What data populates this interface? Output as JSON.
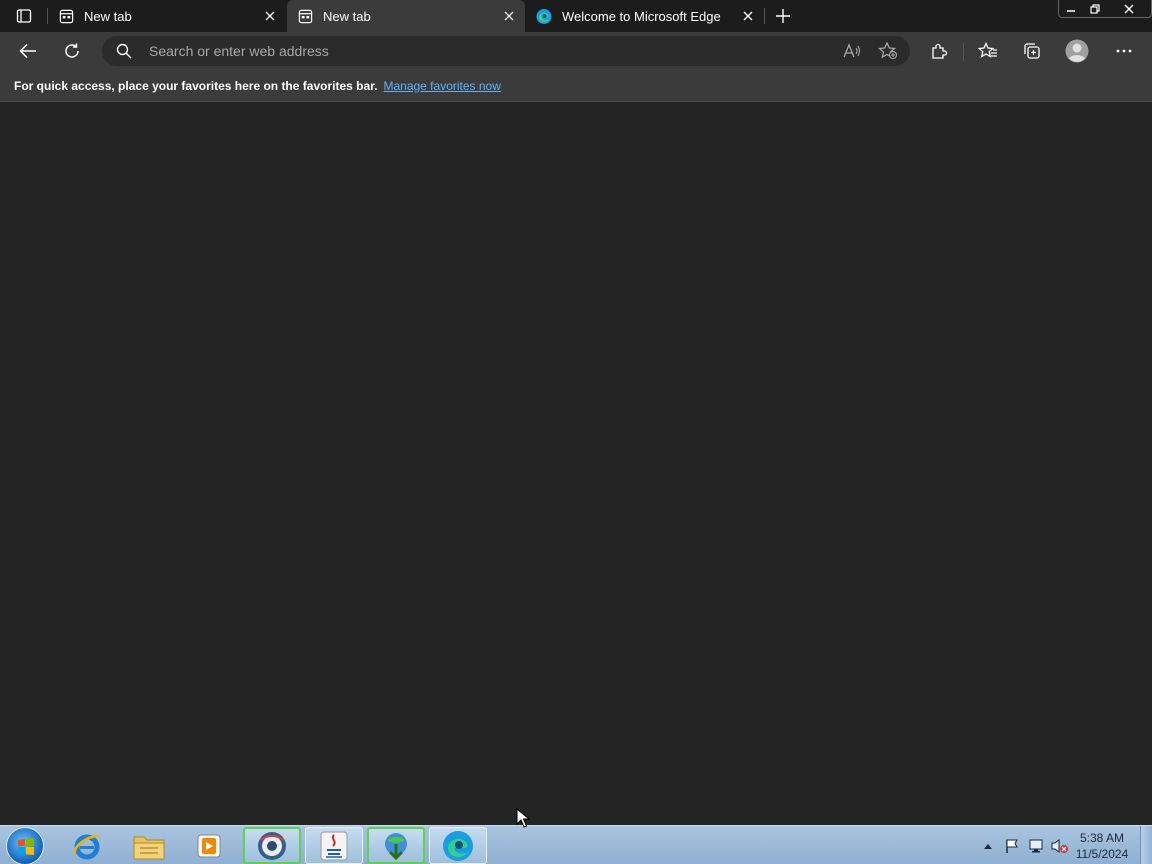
{
  "browser": {
    "tabs": [
      {
        "title": "New tab",
        "icon": "new-tab-page-icon",
        "active": false
      },
      {
        "title": "New tab",
        "icon": "new-tab-page-icon",
        "active": true
      },
      {
        "title": "Welcome to Microsoft Edge",
        "icon": "edge-logo-icon",
        "active": false
      }
    ],
    "address_placeholder": "Search or enter web address",
    "favorites_bar": {
      "message": "For quick access, place your favorites here on the favorites bar.",
      "link": "Manage favorites now"
    }
  },
  "taskbar": {
    "apps": [
      "internet-explorer-icon",
      "file-explorer-icon",
      "media-player-icon",
      "chrome-like-browser-icon",
      "java-icon",
      "download-manager-icon",
      "edge-icon"
    ],
    "clock": {
      "time": "5:38 AM",
      "date": "11/5/2024"
    }
  },
  "colors": {
    "accent_link": "#5fb2f5",
    "background": "#242424",
    "toolbar": "#3b3b3b"
  }
}
